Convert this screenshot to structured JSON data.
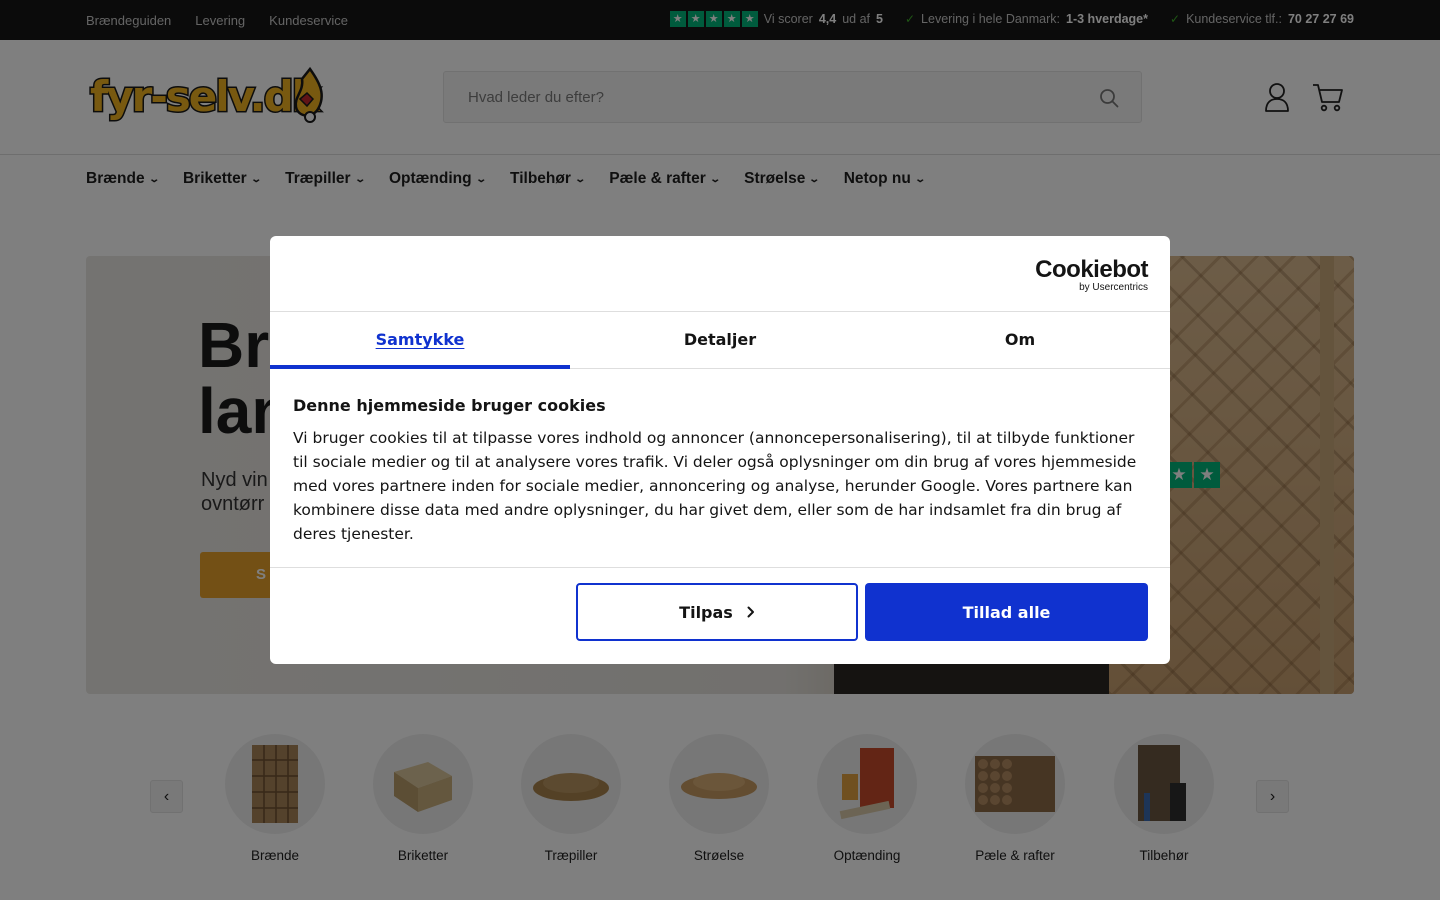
{
  "topbar": {
    "links": [
      "Brændeguiden",
      "Levering",
      "Kundeservice"
    ],
    "rating_prefix": "Vi scorer",
    "rating_value": "4,4",
    "rating_mid": "ud af",
    "rating_max": "5",
    "delivery_text": "Levering i hele Danmark:",
    "delivery_value": "1-3 hverdage*",
    "service_text": "Kundeservice tlf.:",
    "service_phone": "70 27 27 69"
  },
  "header": {
    "logo_text": "fyr-selv.dk",
    "search_placeholder": "Hvad leder du efter?",
    "account_icon": "user-icon",
    "cart_icon": "cart-icon"
  },
  "nav": {
    "items": [
      "Brænde",
      "Briketter",
      "Træpiller",
      "Optænding",
      "Tilbehør",
      "Pæle & rafter",
      "Strøelse",
      "Netop nu"
    ]
  },
  "hero": {
    "title_line1": "Br",
    "title_line2": "lan",
    "subtitle_line1": "Nyd vin",
    "subtitle_line2": "ovntørr",
    "cta_label": "S"
  },
  "categories": {
    "items": [
      "Brænde",
      "Briketter",
      "Træpiller",
      "Strøelse",
      "Optænding",
      "Pæle & rafter",
      "Tilbehør"
    ]
  },
  "cookie": {
    "brand_name": "Cookiebot",
    "brand_sub": "by Usercentrics",
    "tabs": [
      "Samtykke",
      "Detaljer",
      "Om"
    ],
    "heading": "Denne hjemmeside bruger cookies",
    "body": "Vi bruger cookies til at tilpasse vores indhold og annoncer (annoncepersonalisering), til at tilbyde funktioner til sociale medier og til at analysere vores trafik. Vi deler også oplysninger om din brug af vores hjemmeside med vores partnere inden for sociale medier, annoncering og analyse, herunder Google. Vores partnere kan kombinere disse data med andre oplysninger, du har givet dem, eller som de har indsamlet fra din brug af deres tjenester.",
    "customize_label": "Tilpas",
    "allow_all_label": "Tillad alle"
  },
  "colors": {
    "primary": "#1032cf",
    "trustpilot": "#00b67a",
    "cta": "#e7a12b"
  }
}
